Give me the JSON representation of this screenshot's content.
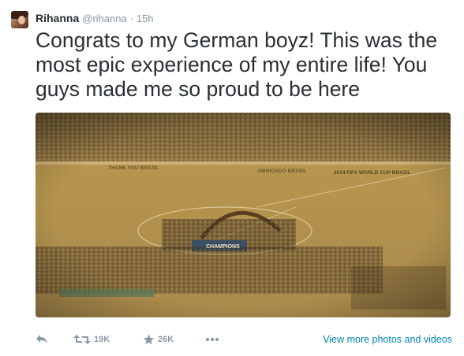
{
  "tweet": {
    "author": {
      "name": "Rihanna",
      "handle": "@rihanna",
      "separator": "·",
      "time": "15h",
      "avatar_icon": "avatar-photo"
    },
    "text": "Congrats to my German boyz! This was the most epic experience of my entire life! You guys made me so proud to be here",
    "photo": {
      "banners": [
        "THANK YOU BRAZIL",
        "OBRIGADO BRASIL",
        "2014 FIFA WORLD CUP BRAZIL"
      ],
      "podium_text": "CHAMPIONS",
      "tint": "#c9a86a"
    },
    "actions": {
      "reply_icon": "reply-icon",
      "retweet_icon": "retweet-icon",
      "retweet_count": "19K",
      "favorite_icon": "star-icon",
      "favorite_count": "26K",
      "more_icon": "more-dots-icon",
      "view_more_label": "View more photos and videos"
    },
    "colors": {
      "text": "#292f33",
      "meta": "#8899a6",
      "link": "#0084b4"
    }
  }
}
